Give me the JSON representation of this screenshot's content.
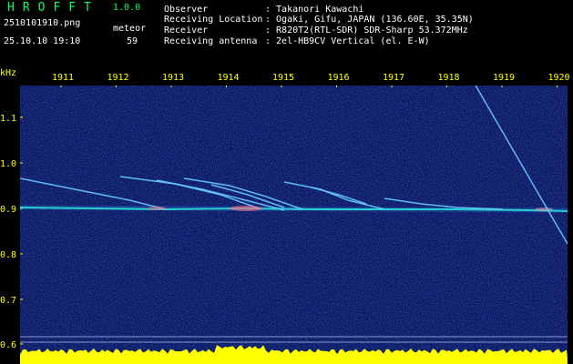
{
  "app": {
    "logo": "HROFFT",
    "version": "1.0.0"
  },
  "file": {
    "name": "2510101910.png",
    "datetime": "25.10.10 19:10"
  },
  "detection": {
    "label": "meteor",
    "count": "59"
  },
  "info": [
    {
      "key": "Observer",
      "value": ": Takanori Kawachi"
    },
    {
      "key": "Receiving Location",
      "value": ": Ogaki, Gifu, JAPAN (136.60E, 35.35N)"
    },
    {
      "key": "Receiver",
      "value": ": R820T2(RTL-SDR) SDR-Sharp 53.372MHz"
    },
    {
      "key": "Receiving antenna",
      "value": ": 2el-HB9CV Vertical (el. E-W)"
    }
  ],
  "yaxis": {
    "unit": "kHz",
    "ticks": [
      "1.1",
      "1.0",
      "0.9",
      "0.8",
      "0.7",
      "0.6"
    ]
  },
  "xaxis": {
    "ticks": [
      "1911",
      "1912",
      "1913",
      "1914",
      "1915",
      "1916",
      "1917",
      "1918",
      "1919",
      "1920"
    ]
  },
  "colors": {
    "background": "#0a1450",
    "text_yellow": "#ffff00",
    "text_green": "#00ff66",
    "signal": "#33ffcc",
    "trace": "#66ccff",
    "power": "#ffff00"
  }
}
